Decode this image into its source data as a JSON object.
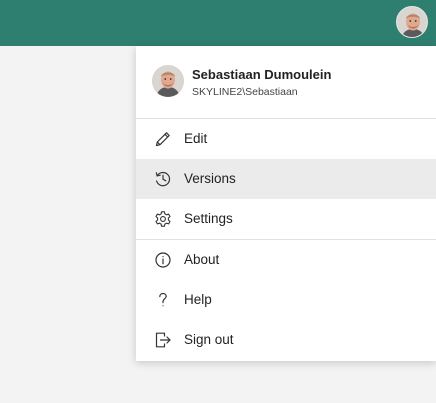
{
  "topbar": {
    "color": "#2f7f71",
    "avatar_icon": "user-avatar"
  },
  "menu": {
    "user": {
      "name": "Sebastiaan Dumoulein",
      "account": "SKYLINE2\\Sebastiaan"
    },
    "items": [
      {
        "label": "Edit",
        "icon": "pencil-icon"
      },
      {
        "label": "Versions",
        "icon": "history-icon"
      },
      {
        "label": "Settings",
        "icon": "gear-icon"
      },
      {
        "label": "About",
        "icon": "info-icon"
      },
      {
        "label": "Help",
        "icon": "question-icon"
      },
      {
        "label": "Sign out",
        "icon": "sign-out-icon"
      }
    ],
    "selected_item": "Versions"
  }
}
